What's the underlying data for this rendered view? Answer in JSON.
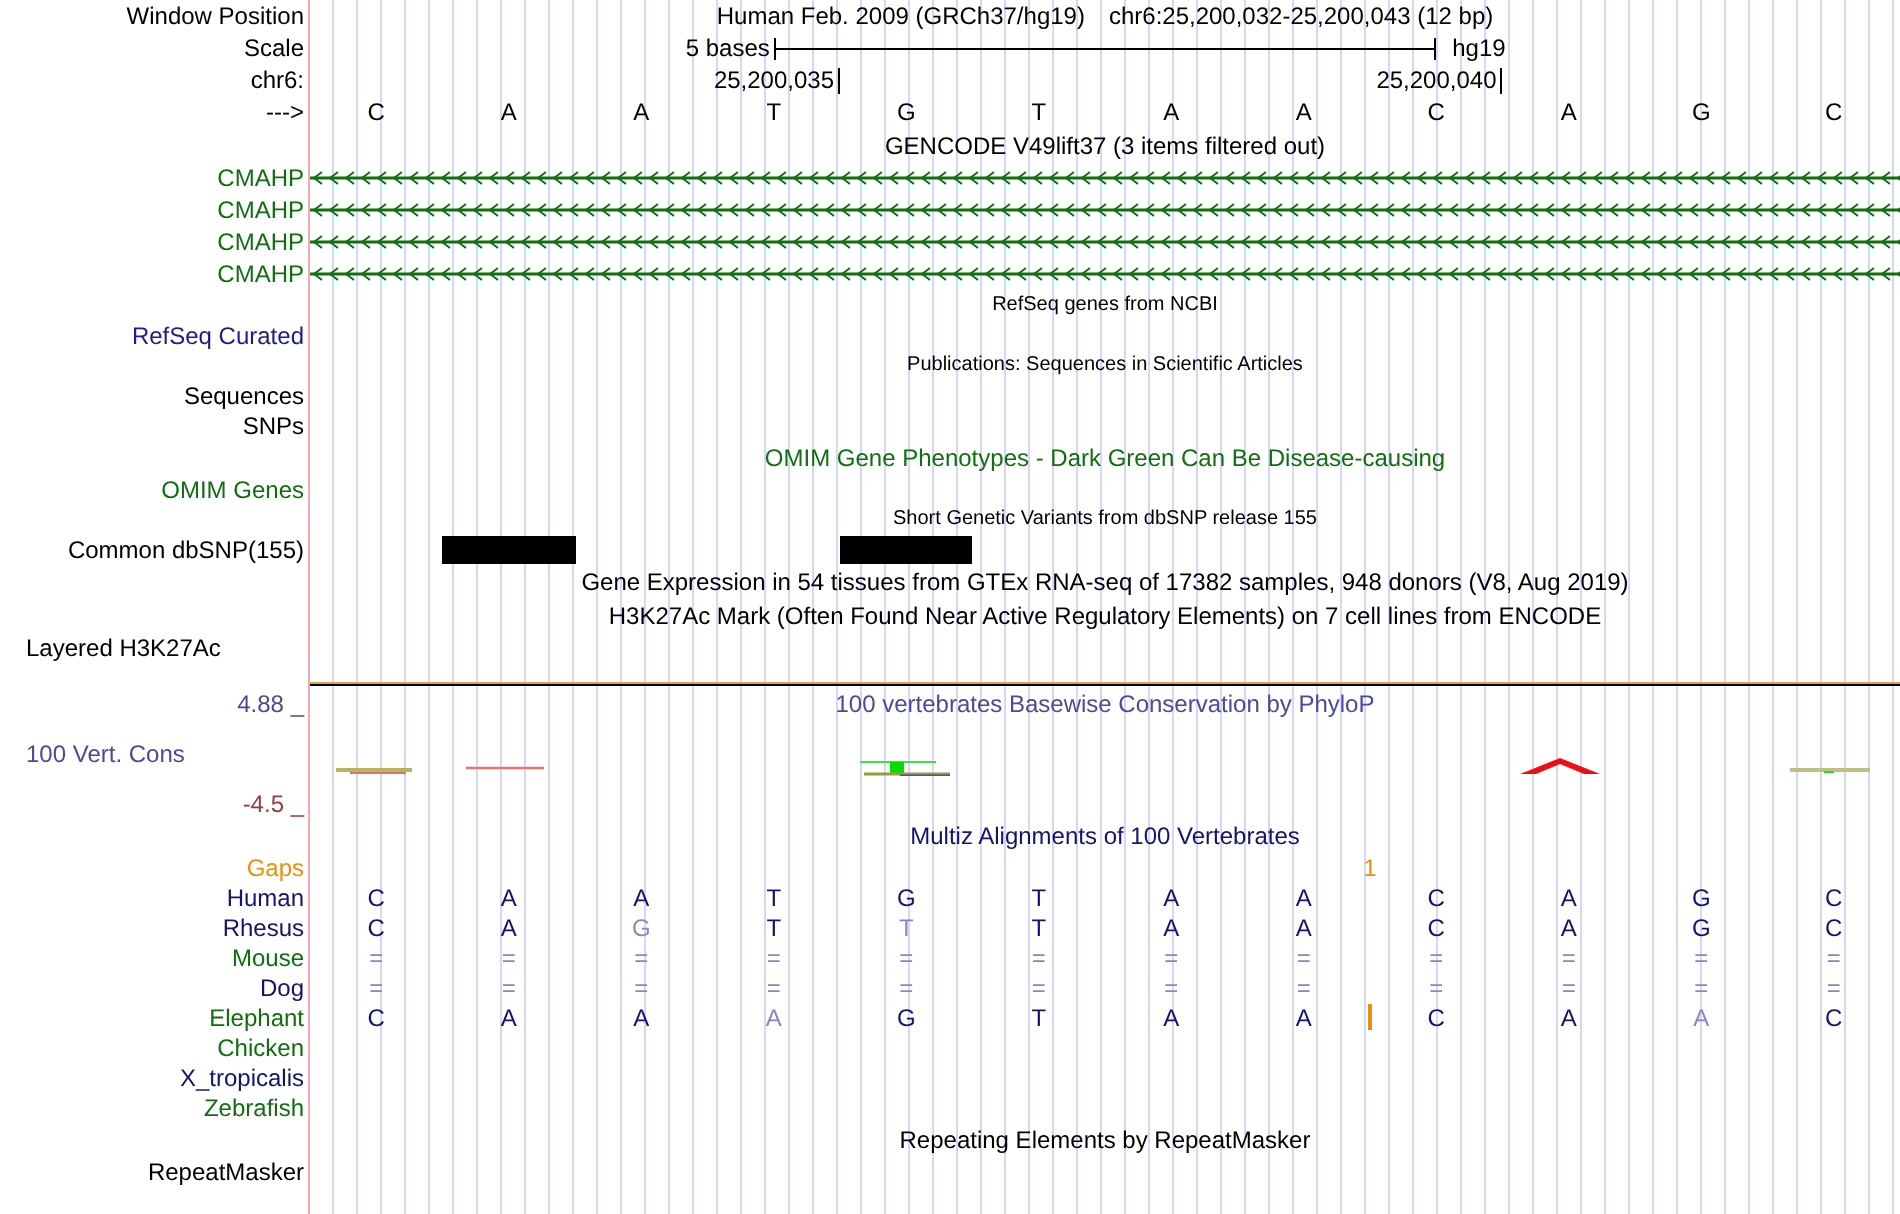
{
  "rows": [
    {
      "kind": "position",
      "label": {
        "text": "Window Position"
      },
      "assembly": "Human Feb. 2009 (GRCh37/hg19)",
      "range": "chr6:25,200,032-25,200,043 (12 bp)"
    },
    {
      "kind": "scale",
      "label": {
        "text": "Scale"
      },
      "span": "5 bases",
      "assembly": "hg19"
    },
    {
      "kind": "coords",
      "label": {
        "text": "chr6:"
      },
      "ticks": [
        "25,200,035",
        "25,200,040"
      ]
    },
    {
      "kind": "bases",
      "label": {
        "text": "--->"
      },
      "bases": [
        "C",
        "A",
        "A",
        "T",
        "G",
        "T",
        "A",
        "A",
        "C",
        "A",
        "G",
        "C"
      ]
    },
    {
      "kind": "title",
      "text": "GENCODE V49lift37 (3 items filtered out)"
    },
    {
      "kind": "gene",
      "label": {
        "text": "CMAHP",
        "color": "#106e10"
      }
    },
    {
      "kind": "gene",
      "label": {
        "text": "CMAHP",
        "color": "#106e10"
      }
    },
    {
      "kind": "gene",
      "label": {
        "text": "CMAHP",
        "color": "#106e10"
      }
    },
    {
      "kind": "gene",
      "label": {
        "text": "CMAHP",
        "color": "#106e10"
      }
    },
    {
      "kind": "small_title",
      "text": "RefSeq genes from NCBI"
    },
    {
      "kind": "label",
      "label": {
        "text": "RefSeq Curated",
        "color": "#1c1c8c"
      }
    },
    {
      "kind": "small_title",
      "text": "Publications: Sequences in Scientific Articles"
    },
    {
      "kind": "label",
      "label": {
        "text": "Sequences"
      }
    },
    {
      "kind": "label",
      "label": {
        "text": "SNPs"
      }
    },
    {
      "kind": "title",
      "text": "OMIM Gene Phenotypes - Dark Green Can Be Disease-causing",
      "color": "#106e10"
    },
    {
      "kind": "label",
      "label": {
        "text": "OMIM Genes",
        "color": "#106e10"
      }
    },
    {
      "kind": "small_title",
      "text": "Short Genetic Variants from dbSNP release 155"
    },
    {
      "kind": "snp",
      "label": {
        "text": "Common dbSNP(155)"
      },
      "cells": [
        {
          "kind": "empty"
        },
        {
          "kind": "variant"
        },
        {
          "kind": "empty"
        },
        {
          "kind": "empty"
        },
        {
          "kind": "variant"
        },
        {
          "kind": "empty"
        },
        {
          "kind": "empty"
        },
        {
          "kind": "empty"
        },
        {
          "kind": "empty"
        },
        {
          "kind": "empty"
        },
        {
          "kind": "empty"
        },
        {
          "kind": "empty"
        }
      ]
    },
    {
      "kind": "title",
      "text": "Gene Expression in 54 tissues from GTEx RNA-seq of 17382 samples, 948 donors (V8, Aug 2019)"
    },
    {
      "kind": "title",
      "text": "H3K27Ac Mark (Often Found Near Active Regulatory Elements) on 7 cell lines from ENCODE"
    },
    {
      "kind": "label",
      "label": {
        "text": "Layered H3K27Ac",
        "left_aligned": true
      }
    },
    {
      "kind": "separator"
    },
    {
      "kind": "title",
      "text": "100 vertebrates Basewise Conservation by PhyloP",
      "color": "#4a4a9a",
      "label": {
        "text": "4.88 _",
        "color": "#4a4a9a"
      }
    },
    {
      "kind": "wiggle",
      "label": {
        "text": "100 Vert. Cons",
        "color": "#4a4a9a",
        "left_aligned": true
      }
    },
    {
      "kind": "label",
      "label": {
        "text": "-4.5 _",
        "color": "#9a3a3a"
      }
    },
    {
      "kind": "title",
      "text": "Multiz Alignments of 100 Vertebrates",
      "color": "#14146e"
    },
    {
      "kind": "gaps",
      "label": {
        "text": "Gaps",
        "color": "#e8900a"
      },
      "cells": [
        {
          "kind": "blank"
        },
        {
          "kind": "blank"
        },
        {
          "kind": "blank"
        },
        {
          "kind": "blank"
        },
        {
          "kind": "blank"
        },
        {
          "kind": "blank"
        },
        {
          "kind": "blank"
        },
        {
          "kind": "blank"
        },
        {
          "kind": "count",
          "text": "1"
        },
        {
          "kind": "blank"
        },
        {
          "kind": "blank"
        },
        {
          "kind": "blank"
        },
        {
          "kind": "blank"
        }
      ]
    },
    {
      "kind": "species",
      "label": {
        "text": "Human",
        "color": "#14146e"
      },
      "cells": [
        {
          "kind": "base",
          "text": "C",
          "faded": false
        },
        {
          "kind": "base",
          "text": "A",
          "faded": false
        },
        {
          "kind": "base",
          "text": "A",
          "faded": false
        },
        {
          "kind": "base",
          "text": "T",
          "faded": false
        },
        {
          "kind": "base",
          "text": "G",
          "faded": false
        },
        {
          "kind": "base",
          "text": "T",
          "faded": false
        },
        {
          "kind": "base",
          "text": "A",
          "faded": false
        },
        {
          "kind": "base",
          "text": "A",
          "faded": false
        },
        {
          "kind": "base",
          "text": "C",
          "faded": false
        },
        {
          "kind": "base",
          "text": "A",
          "faded": false
        },
        {
          "kind": "base",
          "text": "G",
          "faded": false
        },
        {
          "kind": "base",
          "text": "C",
          "faded": false
        }
      ]
    },
    {
      "kind": "species",
      "label": {
        "text": "Rhesus",
        "color": "#14146e"
      },
      "cells": [
        {
          "kind": "base",
          "text": "C",
          "faded": false
        },
        {
          "kind": "base",
          "text": "A",
          "faded": false
        },
        {
          "kind": "base",
          "text": "G",
          "faded": true
        },
        {
          "kind": "base",
          "text": "T",
          "faded": false
        },
        {
          "kind": "base",
          "text": "T",
          "faded": true
        },
        {
          "kind": "base",
          "text": "T",
          "faded": false
        },
        {
          "kind": "base",
          "text": "A",
          "faded": false
        },
        {
          "kind": "base",
          "text": "A",
          "faded": false
        },
        {
          "kind": "base",
          "text": "C",
          "faded": false
        },
        {
          "kind": "base",
          "text": "A",
          "faded": false
        },
        {
          "kind": "base",
          "text": "G",
          "faded": false
        },
        {
          "kind": "base",
          "text": "C",
          "faded": false
        }
      ]
    },
    {
      "kind": "species",
      "label": {
        "text": "Mouse",
        "color": "#106e10"
      },
      "cells": [
        {
          "kind": "base",
          "text": "=",
          "faded": true
        },
        {
          "kind": "base",
          "text": "=",
          "faded": true
        },
        {
          "kind": "base",
          "text": "=",
          "faded": true
        },
        {
          "kind": "base",
          "text": "=",
          "faded": true
        },
        {
          "kind": "base",
          "text": "=",
          "faded": true
        },
        {
          "kind": "base",
          "text": "=",
          "faded": true
        },
        {
          "kind": "base",
          "text": "=",
          "faded": true
        },
        {
          "kind": "base",
          "text": "=",
          "faded": true
        },
        {
          "kind": "base",
          "text": "=",
          "faded": true
        },
        {
          "kind": "base",
          "text": "=",
          "faded": true
        },
        {
          "kind": "base",
          "text": "=",
          "faded": true
        },
        {
          "kind": "base",
          "text": "=",
          "faded": true
        }
      ]
    },
    {
      "kind": "species",
      "label": {
        "text": "Dog",
        "color": "#14146e"
      },
      "cells": [
        {
          "kind": "base",
          "text": "=",
          "faded": true
        },
        {
          "kind": "base",
          "text": "=",
          "faded": true
        },
        {
          "kind": "base",
          "text": "=",
          "faded": true
        },
        {
          "kind": "base",
          "text": "=",
          "faded": true
        },
        {
          "kind": "base",
          "text": "=",
          "faded": true
        },
        {
          "kind": "base",
          "text": "=",
          "faded": true
        },
        {
          "kind": "base",
          "text": "=",
          "faded": true
        },
        {
          "kind": "base",
          "text": "=",
          "faded": true
        },
        {
          "kind": "base",
          "text": "=",
          "faded": true
        },
        {
          "kind": "base",
          "text": "=",
          "faded": true
        },
        {
          "kind": "base",
          "text": "=",
          "faded": true
        },
        {
          "kind": "base",
          "text": "=",
          "faded": true
        }
      ]
    },
    {
      "kind": "species",
      "label": {
        "text": "Elephant",
        "color": "#106e10"
      },
      "cells": [
        {
          "kind": "base",
          "text": "C",
          "faded": false
        },
        {
          "kind": "base",
          "text": "A",
          "faded": false
        },
        {
          "kind": "base",
          "text": "A",
          "faded": false
        },
        {
          "kind": "base",
          "text": "A",
          "faded": true
        },
        {
          "kind": "base",
          "text": "G",
          "faded": false
        },
        {
          "kind": "base",
          "text": "T",
          "faded": false
        },
        {
          "kind": "base",
          "text": "A",
          "faded": false
        },
        {
          "kind": "base",
          "text": "A",
          "faded": false
        },
        {
          "kind": "insertion"
        },
        {
          "kind": "base",
          "text": "C",
          "faded": false
        },
        {
          "kind": "base",
          "text": "A",
          "faded": false
        },
        {
          "kind": "base",
          "text": "A",
          "faded": true
        },
        {
          "kind": "base",
          "text": "C",
          "faded": false
        }
      ]
    },
    {
      "kind": "species",
      "label": {
        "text": "Chicken",
        "color": "#106e10"
      }
    },
    {
      "kind": "species",
      "label": {
        "text": "X_tropicalis",
        "color": "#14146e"
      }
    },
    {
      "kind": "species",
      "label": {
        "text": "Zebrafish",
        "color": "#106e10"
      }
    },
    {
      "kind": "title",
      "text": "Repeating Elements by RepeatMasker"
    },
    {
      "kind": "label",
      "label": {
        "text": "RepeatMasker"
      }
    }
  ]
}
